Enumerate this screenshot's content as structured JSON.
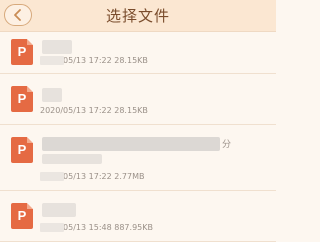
{
  "header": {
    "title": "选择文件",
    "back_icon": "chevron-left-icon"
  },
  "files": [
    {
      "icon": "ppt-file-icon",
      "icon_letter": "P",
      "meta": "2020/05/13 17:22  28.15KB",
      "size": "28.15KB"
    },
    {
      "icon": "ppt-file-icon",
      "icon_letter": "P",
      "meta": "2020/05/13 17:22  28.15KB",
      "size": "28.15KB"
    },
    {
      "icon": "ppt-file-icon",
      "icon_letter": "P",
      "meta": "2020/05/13 17:22  2.77MB",
      "size": "2.77MB",
      "name_trail": "分"
    },
    {
      "icon": "ppt-file-icon",
      "icon_letter": "P",
      "meta": "2020/05/13 15:48  887.95KB",
      "size": "887.95KB"
    }
  ],
  "colors": {
    "header_bg": "#fbe7d2",
    "page_bg": "#fdf7f0",
    "accent_text": "#7a4c2c",
    "ppt_icon": "#e56a43"
  }
}
